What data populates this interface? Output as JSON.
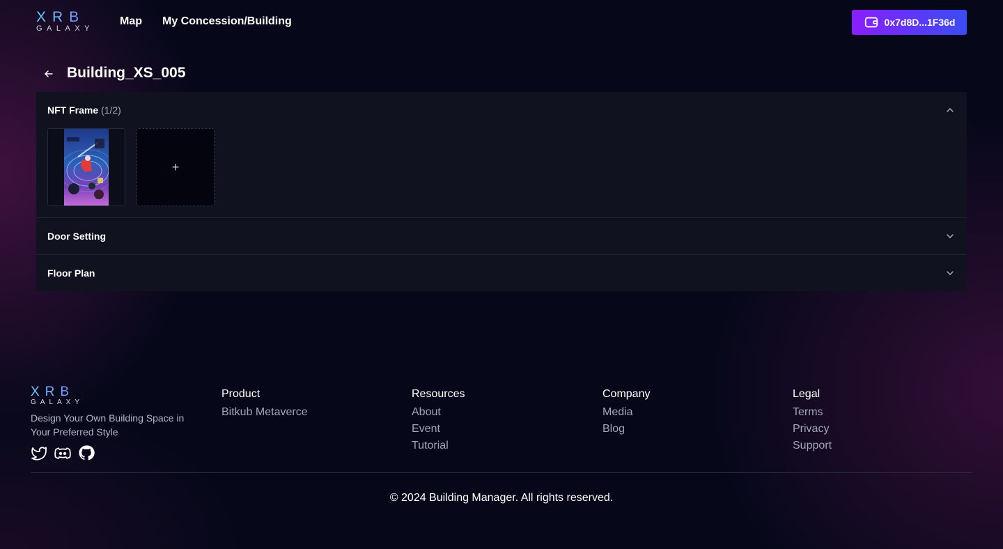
{
  "brand": {
    "logo_top": "XRB",
    "logo_bottom": "GALAXY"
  },
  "nav": {
    "map_label": "Map",
    "concession_label": "My Concession/Building",
    "wallet_address": "0x7d8D...1F36d"
  },
  "page": {
    "title": "Building_XS_005"
  },
  "sections": {
    "nft_frame": {
      "title": "NFT Frame",
      "count": "(1/2)",
      "add_symbol": "+"
    },
    "door_setting": {
      "title": "Door Setting"
    },
    "floor_plan": {
      "title": "Floor Plan"
    }
  },
  "footer": {
    "tagline": "Design Your Own Building Space in Your Preferred Style",
    "columns": [
      {
        "heading": "Product",
        "links": [
          "Bitkub Metaverce"
        ]
      },
      {
        "heading": "Resources",
        "links": [
          "About",
          "Event",
          "Tutorial"
        ]
      },
      {
        "heading": "Company",
        "links": [
          "Media",
          "Blog"
        ]
      },
      {
        "heading": "Legal",
        "links": [
          "Terms",
          "Privacy",
          "Support"
        ]
      }
    ],
    "copyright": "© 2024 Building Manager. All rights reserved."
  },
  "colors": {
    "background": "#06081a",
    "panel": "#10121f",
    "wallet_gradient_start": "#8a1eff",
    "wallet_gradient_end": "#3b4cf5",
    "logo_gradient_start": "#5fd4ff",
    "logo_gradient_end": "#8a7bff"
  },
  "icons": [
    "back-arrow-icon",
    "wallet-icon",
    "chevron-up-icon",
    "chevron-down-icon",
    "plus-icon",
    "twitter-icon",
    "discord-icon",
    "github-icon"
  ]
}
